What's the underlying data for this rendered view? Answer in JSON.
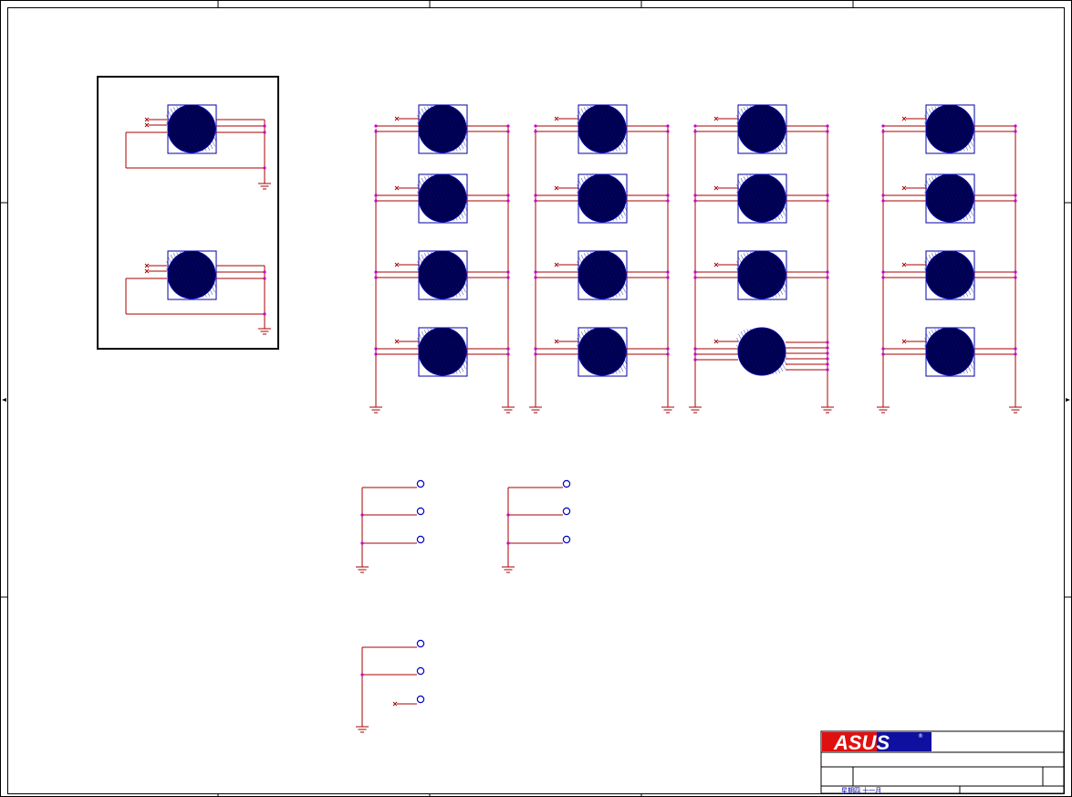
{
  "sheet": {
    "title_block": {
      "logo_text": "ASUS",
      "registered_mark": "®",
      "date_text": "星期四 十一月"
    }
  },
  "colors": {
    "border": "#000000",
    "frame_inner": "#000000",
    "wire": "#aa0000",
    "junction": "#cc00cc",
    "symbol_outline": "#0000aa",
    "symbol_fill": "#000050",
    "test_point": "#0000cc",
    "logo_red": "#e01010",
    "logo_blue": "#1010a0"
  },
  "icons": {
    "ground": "ground-icon",
    "no_connect": "no-connect-icon",
    "mount_hole": "mount-hole-icon",
    "test_point": "test-point-icon"
  },
  "components": {
    "framed_holes": 2,
    "hole_grid_columns": 4,
    "hole_grid_rows": 4,
    "test_point_groups": 3,
    "test_points_per_group": 3
  }
}
